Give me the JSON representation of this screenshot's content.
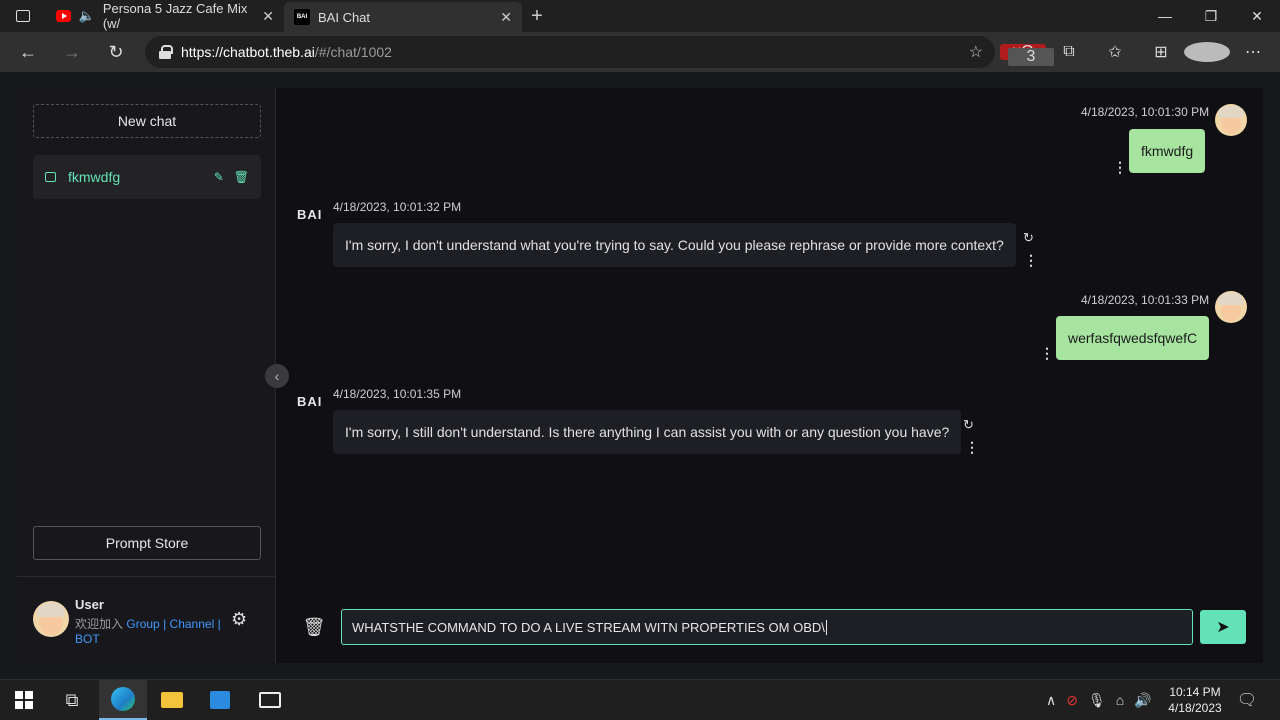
{
  "browser": {
    "tabs": [
      {
        "title": "Persona 5 Jazz Cafe Mix (w/",
        "icon": "youtube-icon",
        "audio": true
      },
      {
        "title": "BAI Chat",
        "icon": "bai-favicon",
        "active": true
      }
    ],
    "url_host": "https://chatbot.theb.ai",
    "url_path": "/#/chat/1002",
    "ublock_badge": "3"
  },
  "sidebar": {
    "new_chat_label": "New chat",
    "chat_items": [
      {
        "label": "fkmwdfg"
      }
    ],
    "prompt_store_label": "Prompt Store",
    "user": {
      "name": "User",
      "welcome": "欢迎加入",
      "group": "Group",
      "sep1": "|",
      "channel": "Channel",
      "sep2": "|",
      "bot": "BOT"
    }
  },
  "messages": [
    {
      "role": "user",
      "time": "4/18/2023, 10:01:30 PM",
      "text": "fkmwdfg"
    },
    {
      "role": "bot",
      "time": "4/18/2023, 10:01:32 PM",
      "text": "I'm sorry, I don't understand what you're trying to say. Could you please rephrase or provide more context?"
    },
    {
      "role": "user",
      "time": "4/18/2023, 10:01:33 PM",
      "text": "werfasfqwedsfqwefC"
    },
    {
      "role": "bot",
      "time": "4/18/2023, 10:01:35 PM",
      "text": "I'm sorry, I still don't understand. Is there anything I can assist you with or any question you have?"
    }
  ],
  "bot_logo": "BAI",
  "input": {
    "value": "WHATSTHE COMMAND TO DO A LIVE STREAM WITN PROPERTIES OM OBD\\"
  },
  "taskbar": {
    "time": "10:14 PM",
    "date": "4/18/2023"
  },
  "colors": {
    "accent": "#63e2b7",
    "user_bubble": "#a6e4a0",
    "link": "#4098fc"
  }
}
